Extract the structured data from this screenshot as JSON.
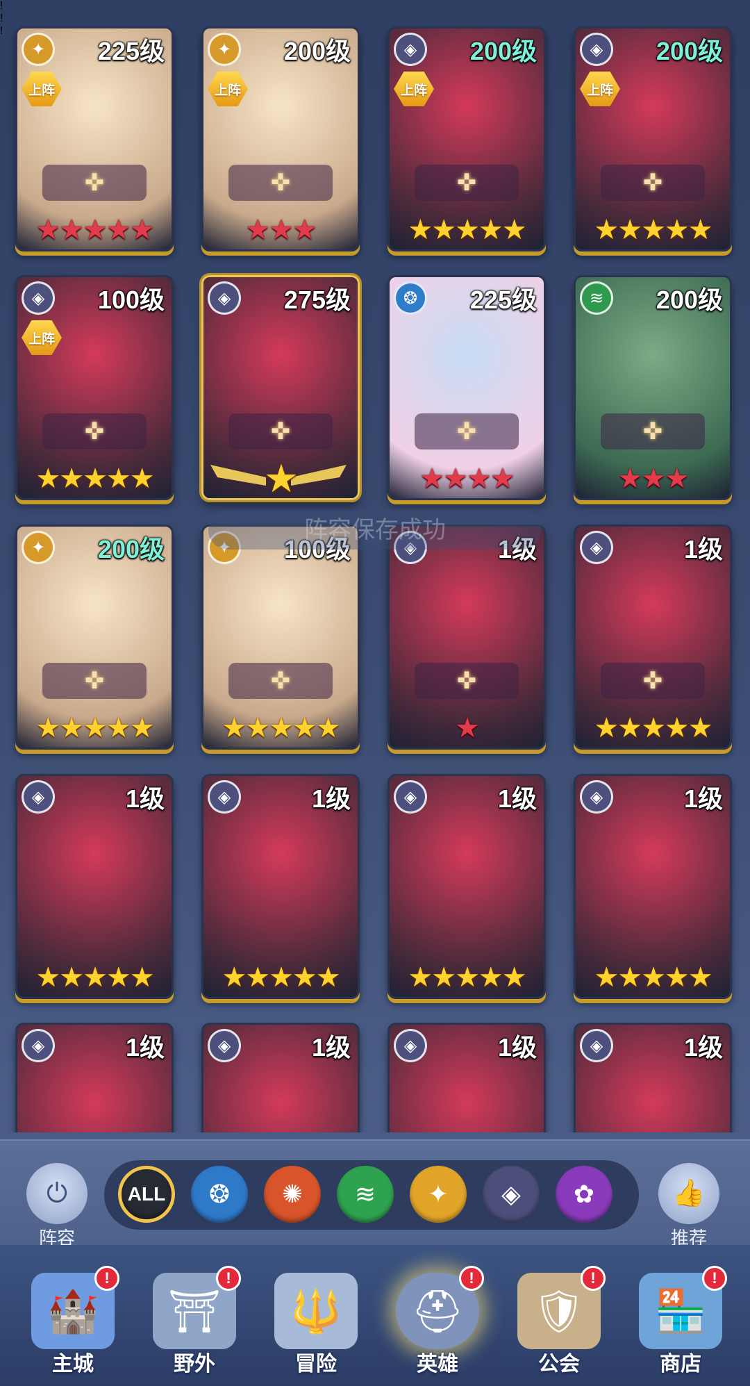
{
  "toast": "阵容保存成功",
  "heroes": [
    {
      "level": "225级",
      "deploy": "上阵",
      "faction": "light",
      "stars": 5,
      "star_color": "red",
      "level_color": "white",
      "notice": "!"
    },
    {
      "level": "200级",
      "deploy": "上阵",
      "faction": "light",
      "stars": 3,
      "star_color": "red",
      "level_color": "white"
    },
    {
      "level": "200级",
      "deploy": "上阵",
      "faction": "dark",
      "stars": 5,
      "star_color": "gold",
      "level_color": "teal"
    },
    {
      "level": "200级",
      "deploy": "上阵",
      "faction": "dark",
      "stars": 5,
      "star_color": "gold",
      "level_color": "teal",
      "notice": "!"
    },
    {
      "level": "100级",
      "deploy": "上阵",
      "faction": "dark",
      "stars": 5,
      "star_color": "gold",
      "level_color": "white",
      "notice": "!"
    },
    {
      "level": "275级",
      "faction": "dark",
      "stars": 1,
      "star_color": "gold",
      "level_color": "white",
      "special": true
    },
    {
      "level": "225级",
      "faction": "water",
      "stars": 4,
      "star_color": "red",
      "level_color": "white"
    },
    {
      "level": "200级",
      "faction": "nature",
      "stars": 3,
      "star_color": "red",
      "level_color": "white"
    },
    {
      "level": "200级",
      "faction": "light",
      "stars": 5,
      "star_color": "gold",
      "level_color": "teal"
    },
    {
      "level": "100级",
      "faction": "light",
      "stars": 5,
      "star_color": "gold",
      "level_color": "white"
    },
    {
      "level": "1级",
      "faction": "dark",
      "stars": 1,
      "star_color": "red",
      "level_color": "white"
    },
    {
      "level": "1级",
      "faction": "dark",
      "stars": 5,
      "star_color": "gold",
      "level_color": "white"
    },
    {
      "level": "1级",
      "faction": "dark",
      "stars": 5,
      "star_color": "gold",
      "level_color": "white"
    },
    {
      "level": "1级",
      "faction": "dark",
      "stars": 5,
      "star_color": "gold",
      "level_color": "white"
    },
    {
      "level": "1级",
      "faction": "dark",
      "stars": 5,
      "star_color": "gold",
      "level_color": "white"
    },
    {
      "level": "1级",
      "faction": "dark",
      "stars": 5,
      "star_color": "gold",
      "level_color": "white"
    },
    {
      "level": "1级",
      "faction": "dark",
      "level_color": "white"
    },
    {
      "level": "1级",
      "faction": "dark",
      "level_color": "white"
    },
    {
      "level": "1级",
      "faction": "dark",
      "level_color": "white"
    },
    {
      "level": "1级",
      "faction": "dark",
      "level_color": "white"
    }
  ],
  "filter": {
    "lineup_label": "阵容",
    "recommend_label": "推荐",
    "all_label": "ALL",
    "factions": [
      {
        "name": "all",
        "color": "#262a33"
      },
      {
        "name": "water",
        "color": "#2f79c9"
      },
      {
        "name": "fire",
        "color": "#d8542a"
      },
      {
        "name": "nature",
        "color": "#2fa24f"
      },
      {
        "name": "light",
        "color": "#e2a52a"
      },
      {
        "name": "dark",
        "color": "#4b4f79"
      },
      {
        "name": "shadow",
        "color": "#8a3bbb"
      }
    ]
  },
  "nav": [
    {
      "label": "主城",
      "icon": "castle-icon",
      "badge": "!"
    },
    {
      "label": "野外",
      "icon": "wild-gate-icon",
      "badge": "!"
    },
    {
      "label": "冒险",
      "icon": "adventure-portal-icon"
    },
    {
      "label": "英雄",
      "icon": "hero-helmet-icon",
      "badge": "!",
      "active": true
    },
    {
      "label": "公会",
      "icon": "guild-banner-icon",
      "badge": "!"
    },
    {
      "label": "商店",
      "icon": "shop-icon",
      "badge": "!"
    }
  ]
}
